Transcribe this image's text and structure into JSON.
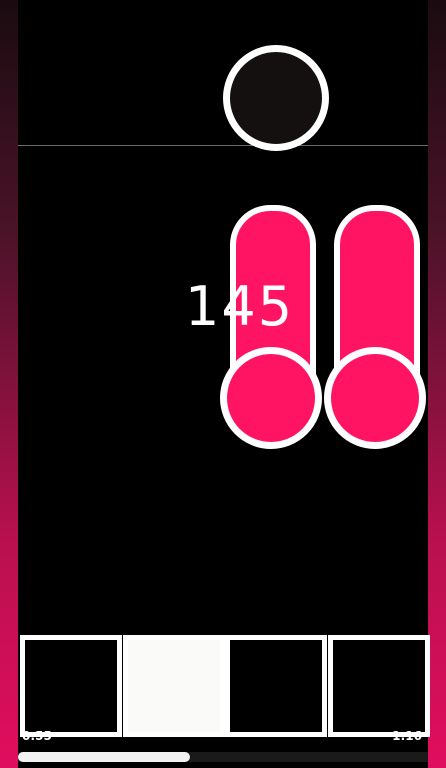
{
  "game": {
    "score": "145",
    "elapsed": "0:55",
    "total": "1:16",
    "progress": 0.42,
    "colors": {
      "note": "#ff1464",
      "edge_glow": "#e10e5e",
      "outline": "#ffffff"
    },
    "lanes": [
      {
        "name": "lane-1",
        "active": false
      },
      {
        "name": "lane-2",
        "active": true
      },
      {
        "name": "lane-3",
        "active": false
      },
      {
        "name": "lane-4",
        "active": false
      }
    ]
  }
}
